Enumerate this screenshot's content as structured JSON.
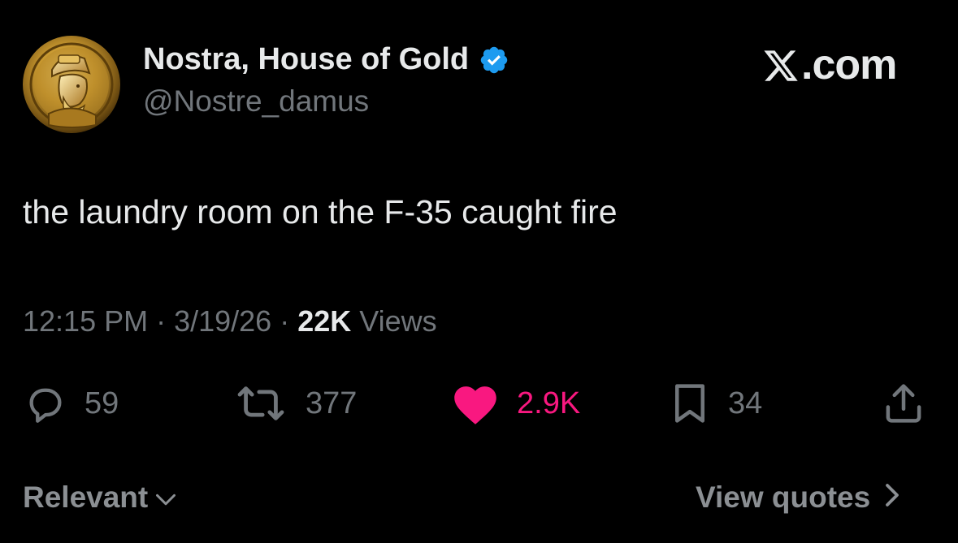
{
  "author": {
    "display_name": "Nostra, House of Gold",
    "handle": "@Nostre_damus",
    "avatar": "gold-coin-portrait",
    "verified": true
  },
  "brand": {
    "site": ".com",
    "logo": "x-logo-icon"
  },
  "tweet": {
    "text": "the laundry room on the F-35 caught fire"
  },
  "meta": {
    "time": "12:15 PM",
    "sep1": " · ",
    "date": "3/19/26",
    "sep2": " · ",
    "views_count": "22K",
    "views_label": " Views"
  },
  "actions": {
    "replies": "59",
    "reposts": "377",
    "likes": "2.9K",
    "bookmarks": "34"
  },
  "footer": {
    "sort_label": "Relevant",
    "quotes_label": "View quotes"
  },
  "colors": {
    "background": "#000000",
    "text": "#e7e9ea",
    "secondary": "#71767b",
    "like": "#f91880",
    "verified": "#1d9bf0"
  }
}
